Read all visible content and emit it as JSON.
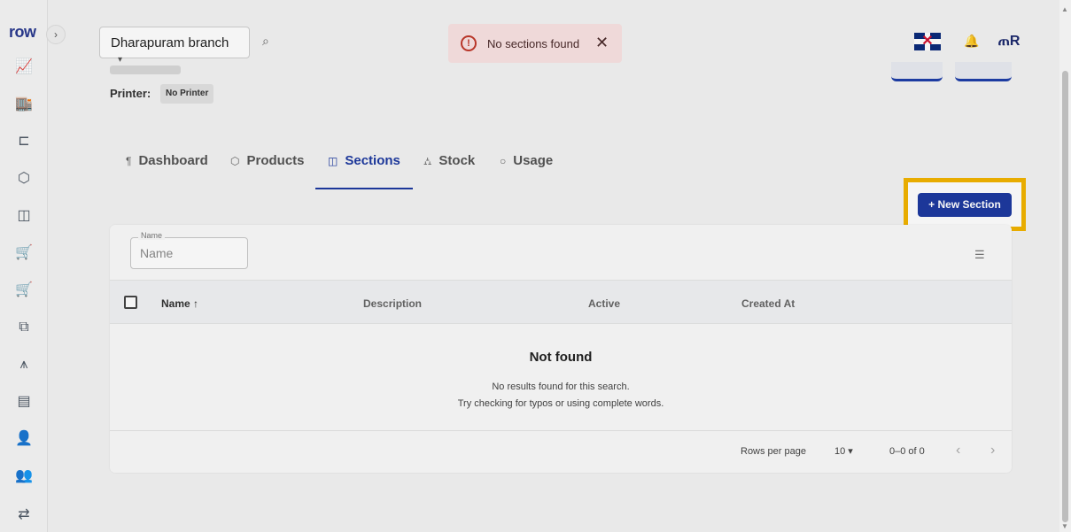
{
  "sidebar": {
    "logo": "row",
    "collapse_glyph": "›",
    "icons": [
      {
        "name": "analytics-icon",
        "glyph": "📈"
      },
      {
        "name": "store-icon",
        "glyph": "🏬"
      },
      {
        "name": "hierarchy-icon",
        "glyph": "⊏"
      },
      {
        "name": "box-icon",
        "glyph": "⬡"
      },
      {
        "name": "bag-icon",
        "glyph": "◫"
      },
      {
        "name": "cart-icon",
        "glyph": "🛒"
      },
      {
        "name": "cart-add-icon",
        "glyph": "🛒"
      },
      {
        "name": "copy-icon",
        "glyph": "⧉"
      },
      {
        "name": "table-service-icon",
        "glyph": "⩚"
      },
      {
        "name": "list-icon",
        "glyph": "▤"
      },
      {
        "name": "user-check-icon",
        "glyph": "👤"
      },
      {
        "name": "group-icon",
        "glyph": "👥"
      },
      {
        "name": "transfer-icon",
        "glyph": "⇄"
      }
    ]
  },
  "header": {
    "branch_label": "Dharapuram branch",
    "caret": "▾",
    "search_glyph": "⌕",
    "bell_glyph": "🔔",
    "brand_glyph": "ጠR"
  },
  "toast": {
    "icon": "!",
    "message": "No sections found",
    "close": "✕"
  },
  "printer": {
    "label": "Printer:",
    "value": "No Printer"
  },
  "tabs": [
    {
      "icon": "¶",
      "label": "Dashboard"
    },
    {
      "icon": "⬡",
      "label": "Products"
    },
    {
      "icon": "◫",
      "label": "Sections"
    },
    {
      "icon": "⛼",
      "label": "Stock"
    },
    {
      "icon": "○",
      "label": "Usage"
    }
  ],
  "active_tab": "Sections",
  "new_section_button": "+ New Section",
  "filter": {
    "label": "Name",
    "placeholder": "Name",
    "filter_glyph": "☰"
  },
  "table": {
    "columns": [
      "Name ↑",
      "Description",
      "Active",
      "Created At"
    ],
    "empty_title": "Not found",
    "empty_line_1": "No results found for this search.",
    "empty_line_2": "Try checking for typos or using complete words."
  },
  "pagination": {
    "rows_per_page_label": "Rows per page",
    "rows_per_page_value": "10 ▾",
    "range": "0–0 of 0",
    "prev": "‹",
    "next": "›"
  },
  "colors": {
    "accent": "#1e3aa0",
    "highlight": "#f2b300",
    "error": "#c0392b"
  }
}
